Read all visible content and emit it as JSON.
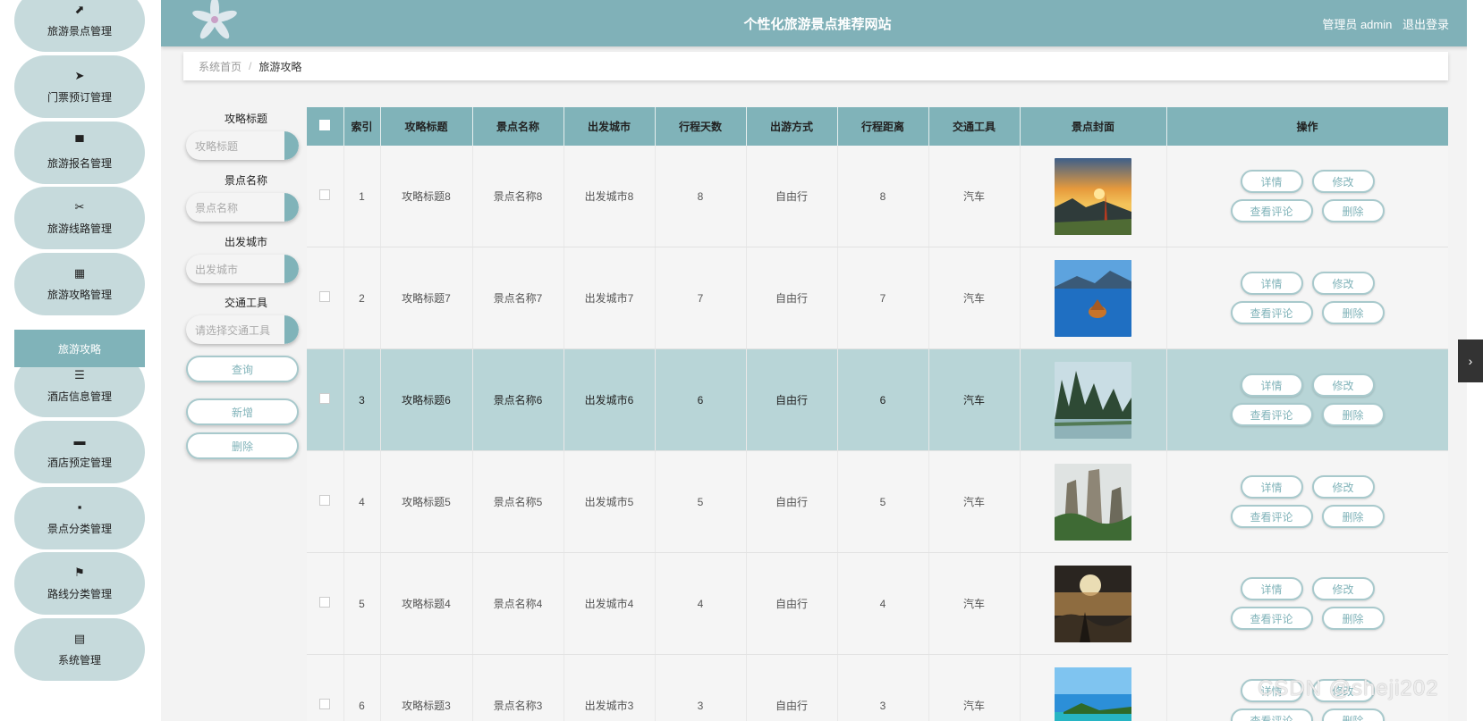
{
  "header": {
    "title": "个性化旅游景点推荐网站",
    "user_label": "管理员 admin",
    "logout_label": "退出登录"
  },
  "sidebar": {
    "items": [
      {
        "label": "旅游景点管理",
        "icon": "chart-line-icon",
        "glyph": "⬈"
      },
      {
        "label": "门票预订管理",
        "icon": "paper-plane-icon",
        "glyph": "➤"
      },
      {
        "label": "旅游报名管理",
        "icon": "desktop-icon",
        "glyph": "▀"
      },
      {
        "label": "旅游线路管理",
        "icon": "ticket-icon",
        "glyph": "✂"
      },
      {
        "label": "旅游攻略管理",
        "icon": "grid-icon",
        "glyph": "▦"
      },
      {
        "label": "酒店信息管理",
        "icon": "sliders-icon",
        "glyph": "☰"
      },
      {
        "label": "酒店预定管理",
        "icon": "briefcase-icon",
        "glyph": "▬"
      },
      {
        "label": "景点分类管理",
        "icon": "apps-icon",
        "glyph": "▪"
      },
      {
        "label": "路线分类管理",
        "icon": "flag-icon",
        "glyph": "⚑"
      },
      {
        "label": "系统管理",
        "icon": "clipboard-icon",
        "glyph": "▤"
      }
    ],
    "active_sub": "旅游攻略"
  },
  "breadcrumb": {
    "home": "系统首页",
    "separator": "/",
    "current": "旅游攻略"
  },
  "search": {
    "title_label": "攻略标题",
    "title_placeholder": "攻略标题",
    "spot_label": "景点名称",
    "spot_placeholder": "景点名称",
    "city_label": "出发城市",
    "city_placeholder": "出发城市",
    "transport_label": "交通工具",
    "transport_placeholder": "请选择交通工具",
    "query_label": "查询",
    "add_label": "新增",
    "delete_label": "删除"
  },
  "table": {
    "headers": [
      "索引",
      "攻略标题",
      "景点名称",
      "出发城市",
      "行程天数",
      "出游方式",
      "行程距离",
      "交通工具",
      "景点封面",
      "操作"
    ],
    "rows": [
      {
        "index": "1",
        "title": "攻略标题8",
        "spot": "景点名称8",
        "city": "出发城市8",
        "days": "8",
        "mode": "自由行",
        "distance": "8",
        "transport": "汽车",
        "cover": "sunset-mountain",
        "highlight": false
      },
      {
        "index": "2",
        "title": "攻略标题7",
        "spot": "景点名称7",
        "city": "出发城市7",
        "days": "7",
        "mode": "自由行",
        "distance": "7",
        "transport": "汽车",
        "cover": "blue-lake",
        "highlight": false
      },
      {
        "index": "3",
        "title": "攻略标题6",
        "spot": "景点名称6",
        "city": "出发城市6",
        "days": "6",
        "mode": "自由行",
        "distance": "6",
        "transport": "汽车",
        "cover": "karst-river",
        "highlight": true
      },
      {
        "index": "4",
        "title": "攻略标题5",
        "spot": "景点名称5",
        "city": "出发城市5",
        "days": "5",
        "mode": "自由行",
        "distance": "5",
        "transport": "汽车",
        "cover": "stone-pillars",
        "highlight": false
      },
      {
        "index": "5",
        "title": "攻略标题4",
        "spot": "景点名称4",
        "city": "出发城市4",
        "days": "4",
        "mode": "自由行",
        "distance": "4",
        "transport": "汽车",
        "cover": "sunrise-clouds",
        "highlight": false
      },
      {
        "index": "6",
        "title": "攻略标题3",
        "spot": "景点名称3",
        "city": "出发城市3",
        "days": "3",
        "mode": "自由行",
        "distance": "3",
        "transport": "汽车",
        "cover": "tropical-beach",
        "highlight": false
      }
    ],
    "actions": {
      "detail": "详情",
      "edit": "修改",
      "comments": "查看评论",
      "delete": "删除"
    }
  },
  "watermark": "CSDN @sheji202",
  "colors": {
    "primary": "#80b3b9",
    "header": "#80b1b8",
    "menu_bg": "#c6dadc",
    "highlight_row": "#b8d5d7"
  }
}
